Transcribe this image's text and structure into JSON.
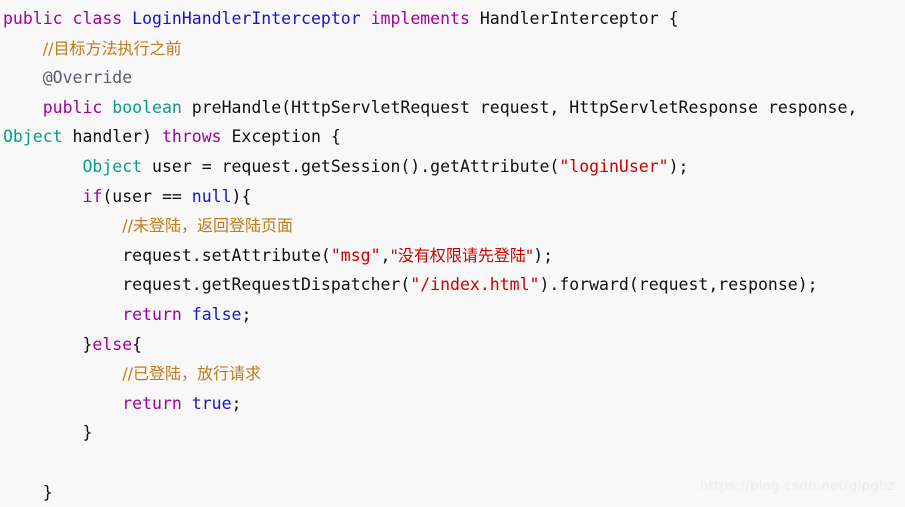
{
  "editor": {
    "language": "java",
    "background_color": "#f8f8f8",
    "colors": {
      "keyword": "#a000a0",
      "class_name": "#1414c8",
      "primitive_type": "#0a9b8a",
      "plain": "#101010",
      "string": "#cc0000",
      "comment": "#c07a18",
      "annotation": "#57606a",
      "watermark": "#ededed"
    },
    "lines": [
      {
        "n": 1,
        "indent": 0,
        "tokens": [
          {
            "t": "public",
            "c": "kw"
          },
          {
            "t": " ",
            "c": "plain"
          },
          {
            "t": "class",
            "c": "kw"
          },
          {
            "t": " ",
            "c": "plain"
          },
          {
            "t": "LoginHandlerInterceptor",
            "c": "type"
          },
          {
            "t": " ",
            "c": "plain"
          },
          {
            "t": "implements",
            "c": "kw"
          },
          {
            "t": " HandlerInterceptor {",
            "c": "plain"
          }
        ]
      },
      {
        "n": 2,
        "indent": 1,
        "tokens": [
          {
            "t": "//目标方法执行之前",
            "c": "cmt"
          }
        ]
      },
      {
        "n": 3,
        "indent": 1,
        "tokens": [
          {
            "t": "@Override",
            "c": "anno"
          }
        ]
      },
      {
        "n": 4,
        "indent": 1,
        "tokens": [
          {
            "t": "public",
            "c": "kw"
          },
          {
            "t": " ",
            "c": "plain"
          },
          {
            "t": "boolean",
            "c": "prim"
          },
          {
            "t": " preHandle(HttpServletRequest request, HttpServletResponse response,",
            "c": "plain"
          }
        ]
      },
      {
        "n": 5,
        "indent": 0,
        "tokens": [
          {
            "t": "Object",
            "c": "prim"
          },
          {
            "t": " handler) ",
            "c": "plain"
          },
          {
            "t": "throws",
            "c": "kw"
          },
          {
            "t": " Exception {",
            "c": "plain"
          }
        ]
      },
      {
        "n": 6,
        "indent": 2,
        "tokens": [
          {
            "t": "Object",
            "c": "prim"
          },
          {
            "t": " user = request.getSession().getAttribute(",
            "c": "plain"
          },
          {
            "t": "\"loginUser\"",
            "c": "str"
          },
          {
            "t": ");",
            "c": "plain"
          }
        ]
      },
      {
        "n": 7,
        "indent": 2,
        "tokens": [
          {
            "t": "if",
            "c": "kw"
          },
          {
            "t": "(user == ",
            "c": "plain"
          },
          {
            "t": "null",
            "c": "type"
          },
          {
            "t": "){",
            "c": "plain"
          }
        ]
      },
      {
        "n": 8,
        "indent": 3,
        "tokens": [
          {
            "t": "//未登陆，返回登陆页面",
            "c": "cmt"
          }
        ]
      },
      {
        "n": 9,
        "indent": 3,
        "tokens": [
          {
            "t": "request.setAttribute(",
            "c": "plain"
          },
          {
            "t": "\"msg\"",
            "c": "str"
          },
          {
            "t": ",",
            "c": "plain"
          },
          {
            "t": "\"没有权限请先登陆\"",
            "c": "str"
          },
          {
            "t": ");",
            "c": "plain"
          }
        ]
      },
      {
        "n": 10,
        "indent": 3,
        "tokens": [
          {
            "t": "request.getRequestDispatcher(",
            "c": "plain"
          },
          {
            "t": "\"/index.html\"",
            "c": "str"
          },
          {
            "t": ").forward(request,response);",
            "c": "plain"
          }
        ]
      },
      {
        "n": 11,
        "indent": 3,
        "tokens": [
          {
            "t": "return",
            "c": "kw"
          },
          {
            "t": " ",
            "c": "plain"
          },
          {
            "t": "false",
            "c": "type"
          },
          {
            "t": ";",
            "c": "plain"
          }
        ]
      },
      {
        "n": 12,
        "indent": 2,
        "tokens": [
          {
            "t": "}",
            "c": "plain"
          },
          {
            "t": "else",
            "c": "kw"
          },
          {
            "t": "{",
            "c": "plain"
          }
        ]
      },
      {
        "n": 13,
        "indent": 3,
        "tokens": [
          {
            "t": "//已登陆，放行请求",
            "c": "cmt"
          }
        ]
      },
      {
        "n": 14,
        "indent": 3,
        "tokens": [
          {
            "t": "return",
            "c": "kw"
          },
          {
            "t": " ",
            "c": "plain"
          },
          {
            "t": "true",
            "c": "type"
          },
          {
            "t": ";",
            "c": "plain"
          }
        ]
      },
      {
        "n": 15,
        "indent": 2,
        "tokens": [
          {
            "t": "}",
            "c": "plain"
          }
        ]
      },
      {
        "n": 16,
        "indent": 0,
        "tokens": []
      },
      {
        "n": 17,
        "indent": 1,
        "tokens": [
          {
            "t": "}",
            "c": "plain"
          }
        ]
      }
    ]
  },
  "watermark": {
    "text": "https://blog.csdn.net/glpghz"
  }
}
